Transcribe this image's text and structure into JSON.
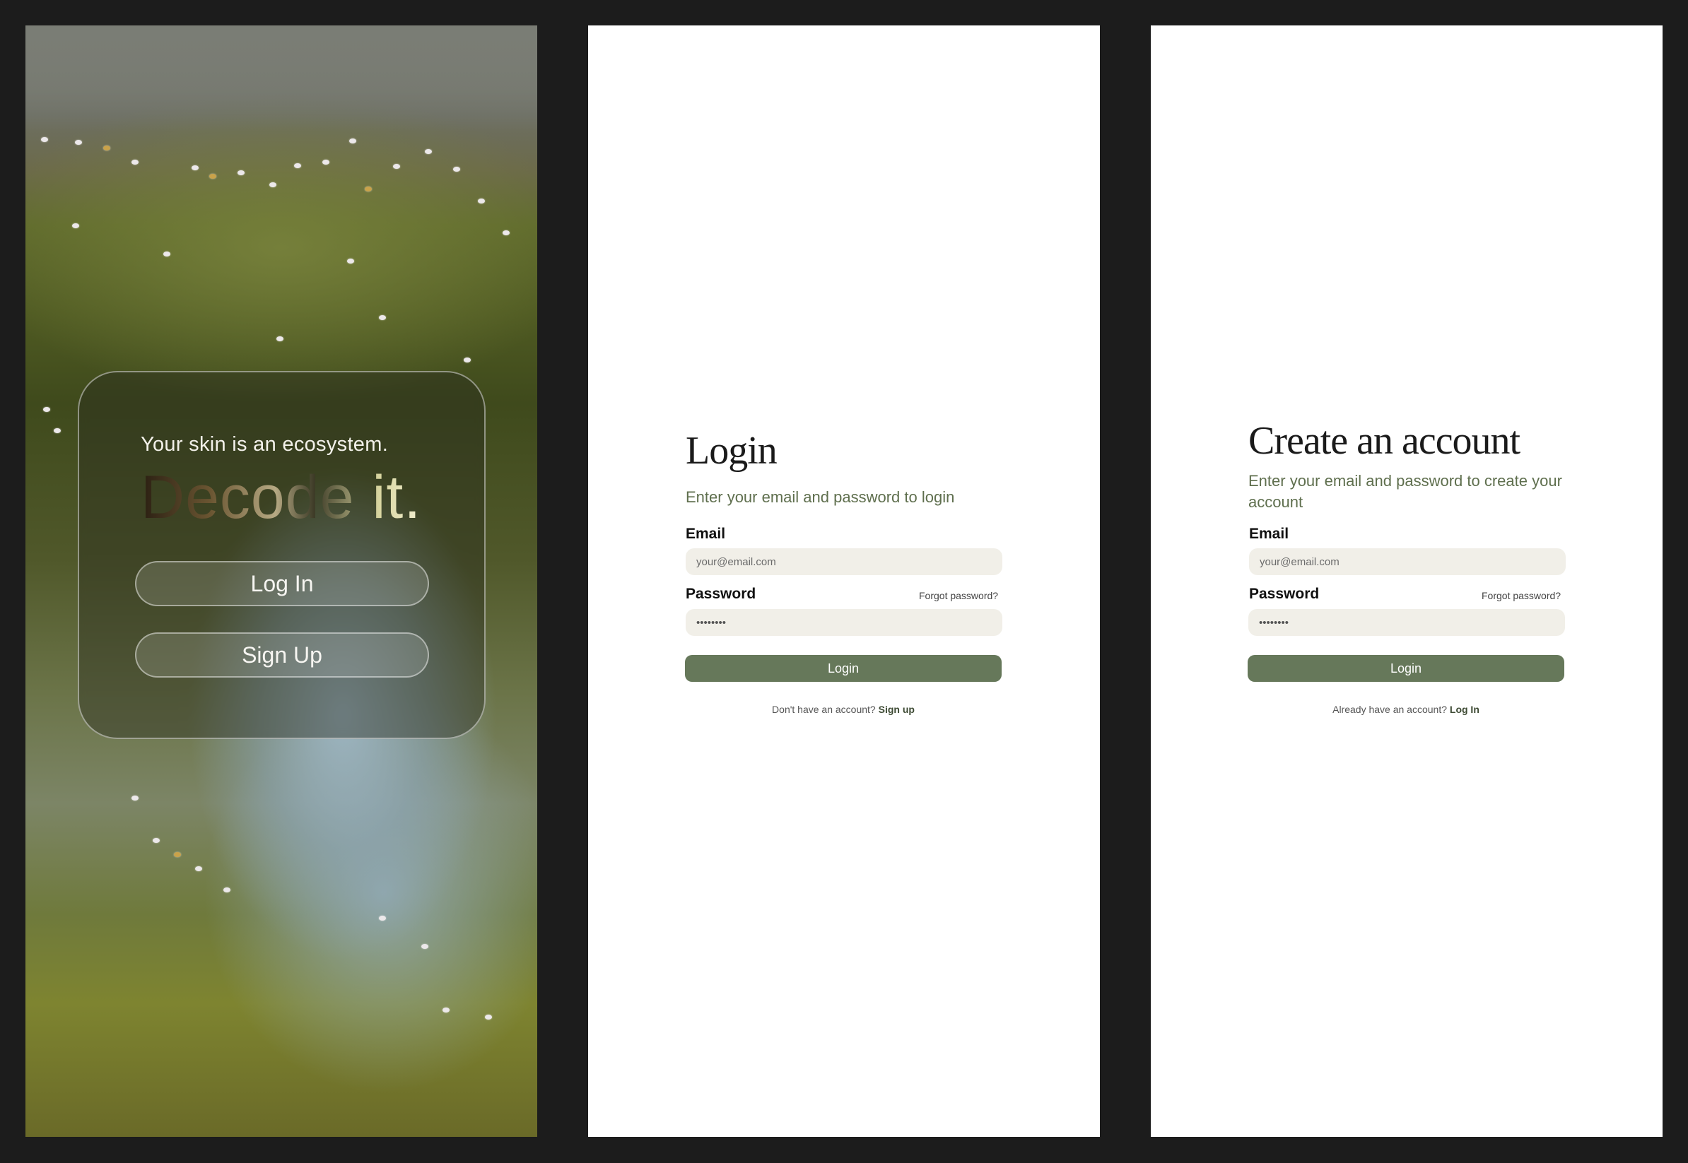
{
  "welcome": {
    "tagline": "Your skin is an ecosystem.",
    "hero": "Decode it.",
    "login_button": "Log In",
    "signup_button": "Sign Up"
  },
  "login": {
    "title": "Login",
    "subtitle": "Enter your email and password to login",
    "email_label": "Email",
    "email_placeholder": "your@email.com",
    "password_label": "Password",
    "password_value": "••••••••",
    "forgot": "Forgot password?",
    "submit": "Login",
    "switch_prompt": "Don't have an account?",
    "switch_link": "Sign up"
  },
  "signup": {
    "title": "Create an account",
    "subtitle": "Enter your email and password to create your account",
    "email_label": "Email",
    "email_placeholder": "your@email.com",
    "password_label": "Password",
    "password_value": "••••••••",
    "forgot": "Forgot password?",
    "submit": "Login",
    "switch_prompt": "Already have an account?",
    "switch_link": "Log In"
  },
  "colors": {
    "canvas": "#1c1c1c",
    "accent": "#66785a",
    "subtitle": "#5f6f4e",
    "input_bg": "#f1efe8"
  }
}
